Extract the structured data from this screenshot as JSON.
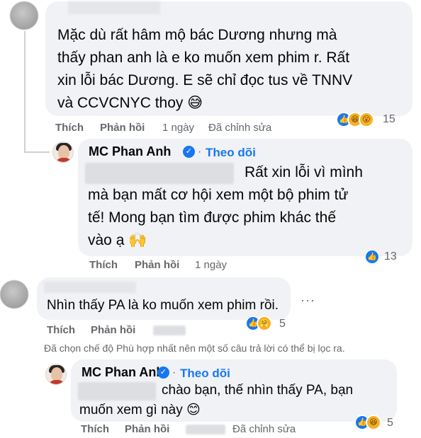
{
  "comment1": {
    "text_lines": [
      "Mặc dù rất hâm mộ bác Dương nhưng mà",
      "thấy phan anh là e ko muốn xem phim r. Rất",
      "xin lỗi bác Dương. E sẽ chỉ đọc tus về TNNV",
      "và CCVCNYC thoy 😅"
    ],
    "actions": {
      "like": "Thích",
      "reply": "Phản hồi",
      "time": "1 ngày",
      "edited": "Đã chỉnh sửa"
    },
    "reactions": {
      "icons": [
        "like-icon",
        "haha-icon",
        "wow-icon"
      ],
      "count": "15"
    }
  },
  "reply1": {
    "author": "MC Phan Anh",
    "separator": "·",
    "follow": "Theo dõi",
    "text_lines": [
      "Rất xin lỗi vì mình",
      "mà bạn mất cơ hội xem một bộ phim tử",
      "tế! Mong bạn tìm được phim khác thế",
      "vào ạ 🙌"
    ],
    "actions": {
      "like": "Thích",
      "reply": "Phản hồi",
      "time": "1 ngày"
    },
    "reactions": {
      "icons": [
        "like-icon"
      ],
      "count": "13"
    }
  },
  "comment2": {
    "text": "Nhìn thấy PA là ko muốn xem phim rồi.",
    "more": "···",
    "actions": {
      "like": "Thích",
      "reply": "Phản hồi"
    },
    "reactions": {
      "icons": [
        "like-icon",
        "care-icon"
      ],
      "count": "5"
    }
  },
  "filter_notice": "Đã chọn chế độ Phù hợp nhất nên một số câu trả lời có thể bị lọc ra.",
  "reply2": {
    "author": "MC Phan Anh",
    "separator": "·",
    "follow": "Theo dõi",
    "text_lines": [
      "chào bạn, thế nhìn thấy PA, bạn",
      "muốn xem gì này 😊"
    ],
    "actions": {
      "like": "Thích",
      "reply": "Phản hồi",
      "edited": "Đã chỉnh sửa"
    },
    "reactions": {
      "icons": [
        "like-icon",
        "haha-icon"
      ],
      "count": "5"
    }
  },
  "colors": {
    "accent": "#1877f2",
    "bubble": "#f0f2f5",
    "meta": "#65676b"
  }
}
